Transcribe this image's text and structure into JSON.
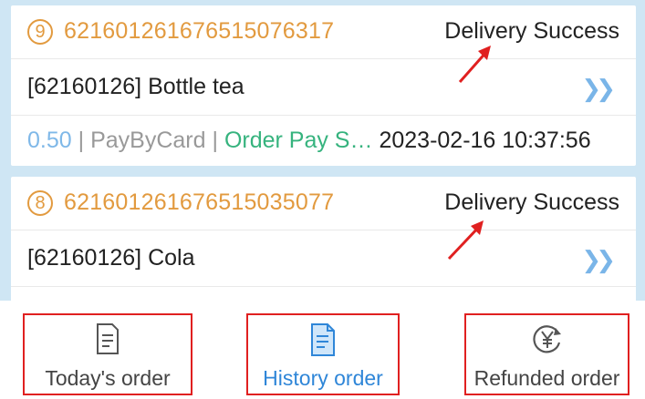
{
  "orders": [
    {
      "index": "9",
      "order_no": "621601261676515076317",
      "status": "Delivery Success",
      "product": "[62160126] Bottle tea",
      "amount": "0.50",
      "payment_method": "PayByCard",
      "pay_status": "Order Pay S…",
      "datetime": "2023-02-16 10:37:56",
      "separator": "|"
    },
    {
      "index": "8",
      "order_no": "621601261676515035077",
      "status": "Delivery Success",
      "product": "[62160126] Cola"
    }
  ],
  "icons": {
    "more": "double-chevron-right-icon",
    "today": "document-icon",
    "history": "document-filled-icon",
    "refund": "yen-refresh-icon"
  },
  "tabs": {
    "today_label": "Today's order",
    "history_label": "History order",
    "refund_label": "Refunded order"
  },
  "colors": {
    "order_no": "#e29a3f",
    "amount": "#7fb8e8",
    "pay_status": "#36b37e",
    "active_tab": "#2f86d8",
    "highlight_box": "#e02020"
  }
}
